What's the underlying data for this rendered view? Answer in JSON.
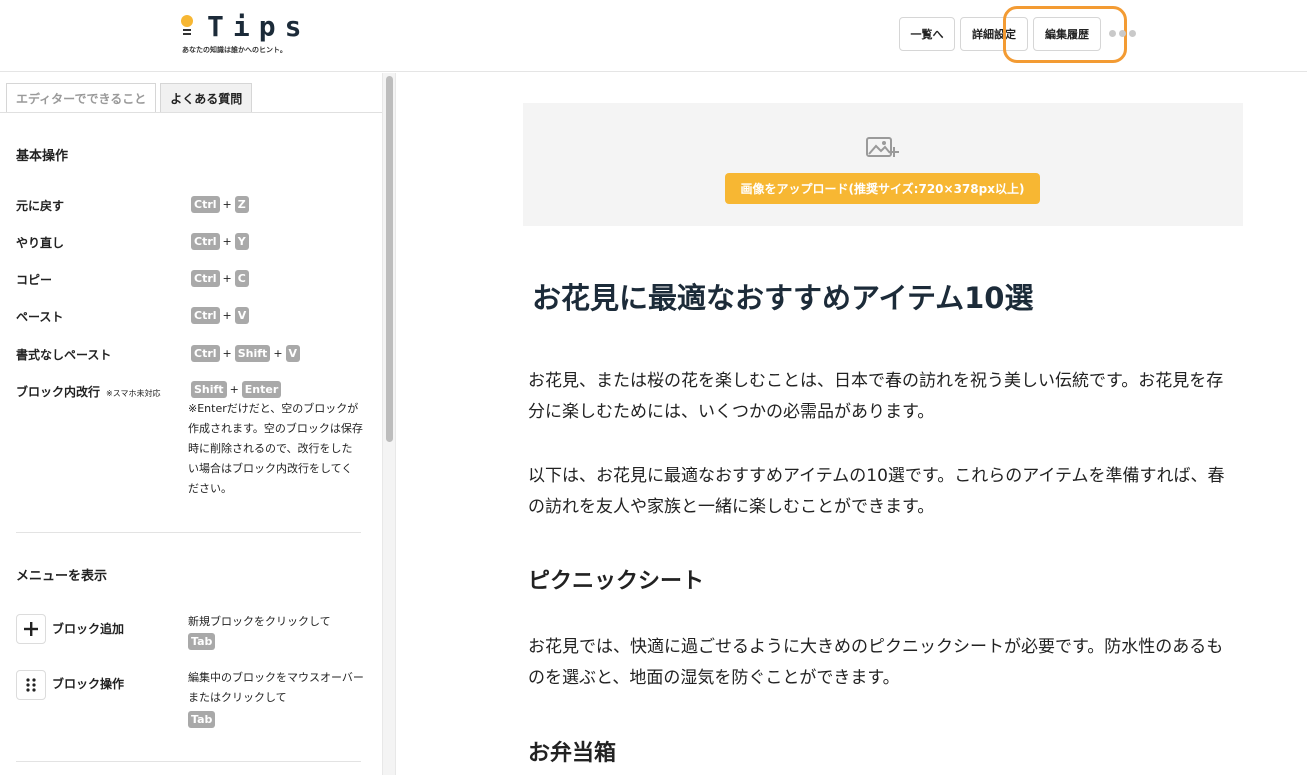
{
  "header": {
    "logo_text": "Tips",
    "logo_tagline": "あなたの知識は誰かへのヒント。",
    "buttons": {
      "list": "一覧へ",
      "detail": "詳細設定",
      "history": "編集履歴"
    }
  },
  "sidebar": {
    "tabs": [
      "エディターでできること",
      "よくある質問"
    ],
    "section1_title": "基本操作",
    "shortcuts": [
      {
        "label": "元に戻す",
        "keys": [
          "Ctrl",
          "Z"
        ]
      },
      {
        "label": "やり直し",
        "keys": [
          "Ctrl",
          "Y"
        ]
      },
      {
        "label": "コピー",
        "keys": [
          "Ctrl",
          "C"
        ]
      },
      {
        "label": "ペースト",
        "keys": [
          "Ctrl",
          "V"
        ]
      },
      {
        "label": "書式なしペースト",
        "keys": [
          "Ctrl",
          "Shift",
          "V"
        ]
      },
      {
        "label": "ブロック内改行",
        "note_small": "※スマホ未対応",
        "keys": [
          "Shift",
          "Enter"
        ]
      }
    ],
    "line_break_note": "※Enterだけだと、空のブロックが作成されます。空のブロックは保存時に削除されるので、改行をしたい場合はブロック内改行をしてください。",
    "section2_title": "メニューを表示",
    "menu_items": [
      {
        "label": "ブロック追加",
        "desc": "新規ブロックをクリックして",
        "key": "Tab"
      },
      {
        "label": "ブロック操作",
        "desc": "編集中のブロックをマウスオーバーまたはクリックして",
        "key": "Tab"
      }
    ]
  },
  "main": {
    "upload_button": "画像をアップロード(推奨サイズ:720×378px以上)",
    "title": "お花見に最適なおすすめアイテム10選",
    "para1": "お花見、または桜の花を楽しむことは、日本で春の訪れを祝う美しい伝統です。お花見を存分に楽しむためには、いくつかの必需品があります。",
    "para2": "以下は、お花見に最適なおすすめアイテムの10選です。これらのアイテムを準備すれば、春の訪れを友人や家族と一緒に楽しむことができます。",
    "h2_1": "ピクニックシート",
    "para3": "お花見では、快適に過ごせるように大きめのピクニックシートが必要です。防水性のあるものを選ぶと、地面の湿気を防ぐことができます。",
    "h2_2": "お弁当箱"
  },
  "colors": {
    "accent": "#f7b733",
    "highlight": "#f39b33",
    "title": "#1c2b39",
    "key_bg": "#a9a9a9"
  }
}
